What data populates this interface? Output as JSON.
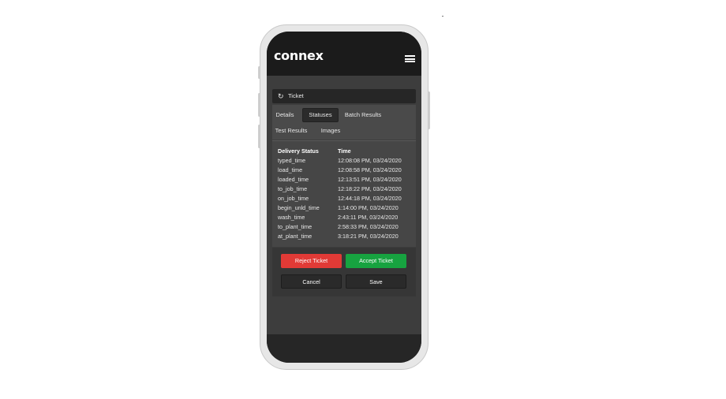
{
  "app": {
    "logo_text": "connex",
    "menu_icon": "hamburger-menu-icon"
  },
  "ticket": {
    "header_icon": "refresh-icon",
    "header_title": "Ticket",
    "tabs": [
      {
        "label": "Details",
        "active": false
      },
      {
        "label": "Statuses",
        "active": true
      },
      {
        "label": "Batch Results",
        "active": false
      },
      {
        "label": "Test Results",
        "active": false
      },
      {
        "label": "Images",
        "active": false
      }
    ],
    "table": {
      "columns": [
        "Delivery Status",
        "Time"
      ],
      "rows": [
        [
          "typed_time",
          "12:08:08 PM, 03/24/2020"
        ],
        [
          "load_time",
          "12:08:58 PM, 03/24/2020"
        ],
        [
          "loaded_time",
          "12:13:51 PM, 03/24/2020"
        ],
        [
          "to_job_time",
          "12:18:22 PM, 03/24/2020"
        ],
        [
          "on_job_time",
          "12:44:18 PM, 03/24/2020"
        ],
        [
          "begin_unld_time",
          "1:14:00 PM, 03/24/2020"
        ],
        [
          "wash_time",
          "2:43:11 PM, 03/24/2020"
        ],
        [
          "to_plant_time",
          "2:58:33 PM, 03/24/2020"
        ],
        [
          "at_plant_time",
          "3:18:21 PM, 03/24/2020"
        ]
      ]
    },
    "actions": {
      "reject_label": "Reject Ticket",
      "accept_label": "Accept Ticket",
      "cancel_label": "Cancel",
      "save_label": "Save"
    }
  },
  "colors": {
    "reject": "#e13a36",
    "accept": "#17a340",
    "background": "#3d3d3d"
  }
}
